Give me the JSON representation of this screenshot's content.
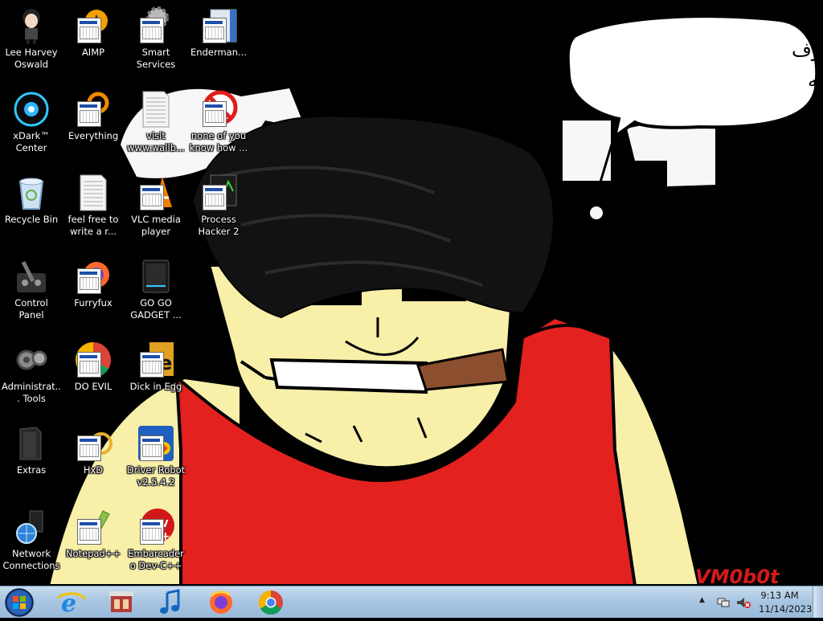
{
  "desktop": {
    "speech_bubble": {
      "line1": "حان وقت أكل القرف",
      "line2": "لموت وتنفيذ مشيئة الله"
    },
    "watermark": "VM0b0t",
    "icons": [
      {
        "label": "Lee Harvey Oswald",
        "icon": "anime-character-icon"
      },
      {
        "label": "AIMP",
        "icon": "aimp-icon"
      },
      {
        "label": "Smart Services",
        "icon": "gear-icon"
      },
      {
        "label": "Enderman...",
        "icon": "enderman-app-icon"
      },
      {
        "label": "xDark™ Center",
        "icon": "xdark-orb-icon"
      },
      {
        "label": "Everything",
        "icon": "everything-search-icon"
      },
      {
        "label": "visit www.wallb...",
        "icon": "text-document-icon"
      },
      {
        "label": "none of you know how ...",
        "icon": "no-sign-icon"
      },
      {
        "label": "Recycle Bin",
        "icon": "recycle-bin-icon"
      },
      {
        "label": "feel free to write a r...",
        "icon": "text-document-icon"
      },
      {
        "label": "VLC media player",
        "icon": "vlc-cone-icon"
      },
      {
        "label": "Process Hacker 2",
        "icon": "process-hacker-icon"
      },
      {
        "label": "Control Panel",
        "icon": "control-panel-icon"
      },
      {
        "label": "Furryfux",
        "icon": "firefox-icon"
      },
      {
        "label": "GO GO GADGET ...",
        "icon": "gadget-icon"
      },
      {
        "label": "Administrat... Tools",
        "icon": "admin-tools-icon"
      },
      {
        "label": "DO EVIL",
        "icon": "chrome-icon"
      },
      {
        "label": "Dick in Egg",
        "icon": "egg-app-icon"
      },
      {
        "label": "Extras",
        "icon": "folder-icon"
      },
      {
        "label": "HxD",
        "icon": "hxd-icon"
      },
      {
        "label": "Driver Robot v2.5.4.2",
        "icon": "driver-robot-icon"
      },
      {
        "label": "Network Connections",
        "icon": "network-globe-icon"
      },
      {
        "label": "Notepad++",
        "icon": "notepad-plus-plus-icon"
      },
      {
        "label": "Embarcadero Dev-C++",
        "icon": "devcpp-icon"
      }
    ]
  },
  "taskbar": {
    "start": "start-orb-icon",
    "pinned": [
      {
        "icon": "internet-explorer-icon"
      },
      {
        "icon": "store-app-icon"
      },
      {
        "icon": "music-note-icon"
      },
      {
        "icon": "firefox-icon"
      },
      {
        "icon": "chrome-icon"
      }
    ],
    "tray": {
      "time": "9:13 AM",
      "date": "11/14/2023"
    }
  },
  "colors": {
    "face": "#f8efa9",
    "shirt": "#e3211f",
    "turban": "#111111",
    "cigar": "#8b4f2f",
    "taskbar": "#a9c6e2"
  }
}
